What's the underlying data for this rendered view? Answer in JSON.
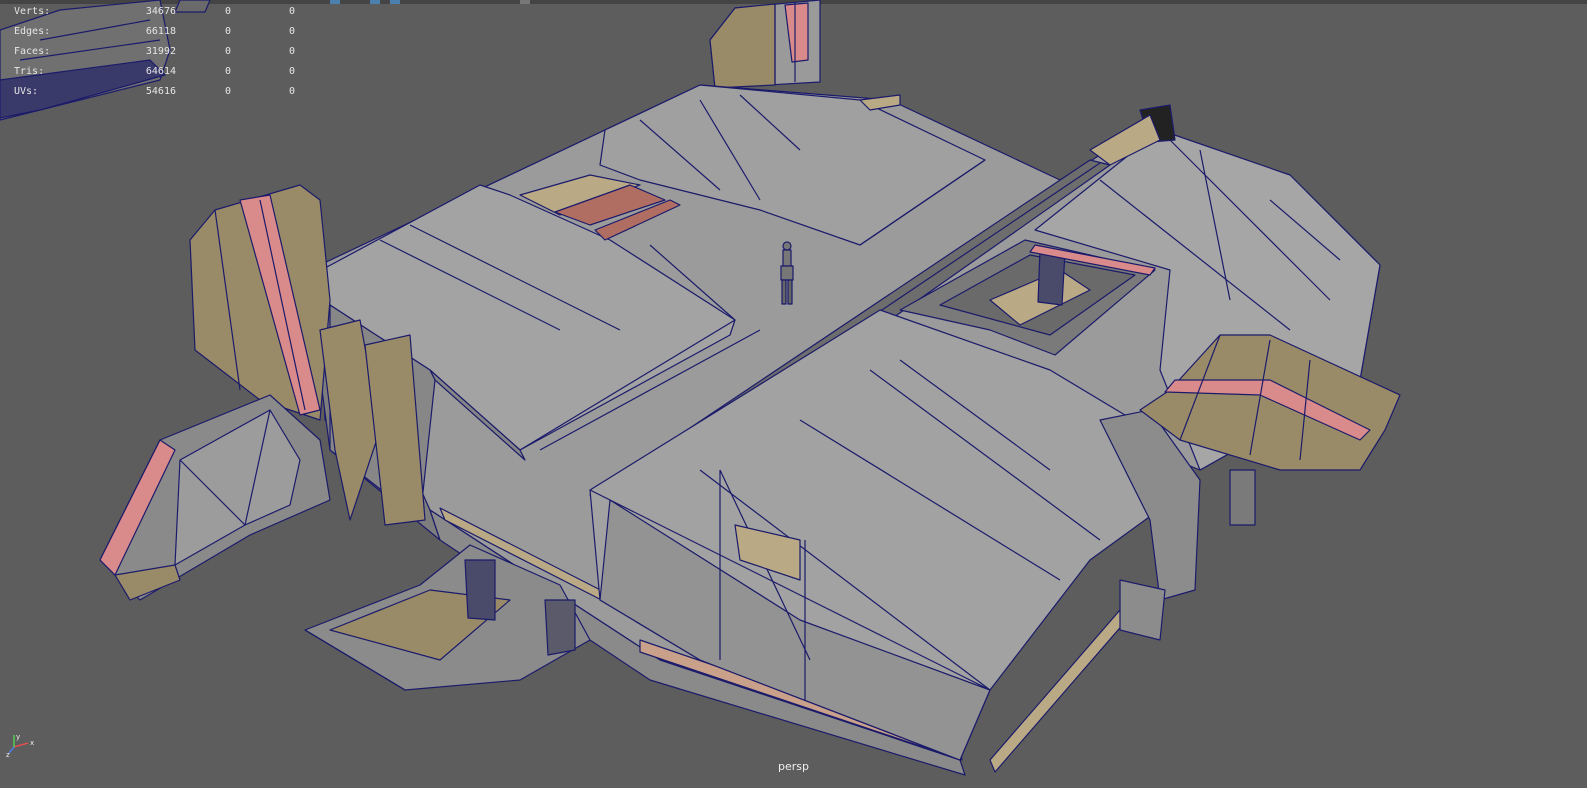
{
  "hud": {
    "rows": [
      {
        "label": "Verts:",
        "v1": "34676",
        "v2": "0",
        "v3": "0"
      },
      {
        "label": "Edges:",
        "v1": "66118",
        "v2": "0",
        "v3": "0"
      },
      {
        "label": "Faces:",
        "v1": "31992",
        "v2": "0",
        "v3": "0"
      },
      {
        "label": "Tris:",
        "v1": "64614",
        "v2": "0",
        "v3": "0"
      },
      {
        "label": "UVs:",
        "v1": "54616",
        "v2": "0",
        "v3": "0"
      }
    ]
  },
  "viewport": {
    "camera_label": "persp",
    "background_color": "#5d5d5d",
    "wire_color": "#1b1b6b",
    "surface_gray": "#9a9a9a",
    "surface_tan": "#9a8b68",
    "surface_pink": "#d98a8a"
  },
  "axis_gizmo": {
    "x_label": "x",
    "y_label": "y",
    "z_label": "z"
  }
}
